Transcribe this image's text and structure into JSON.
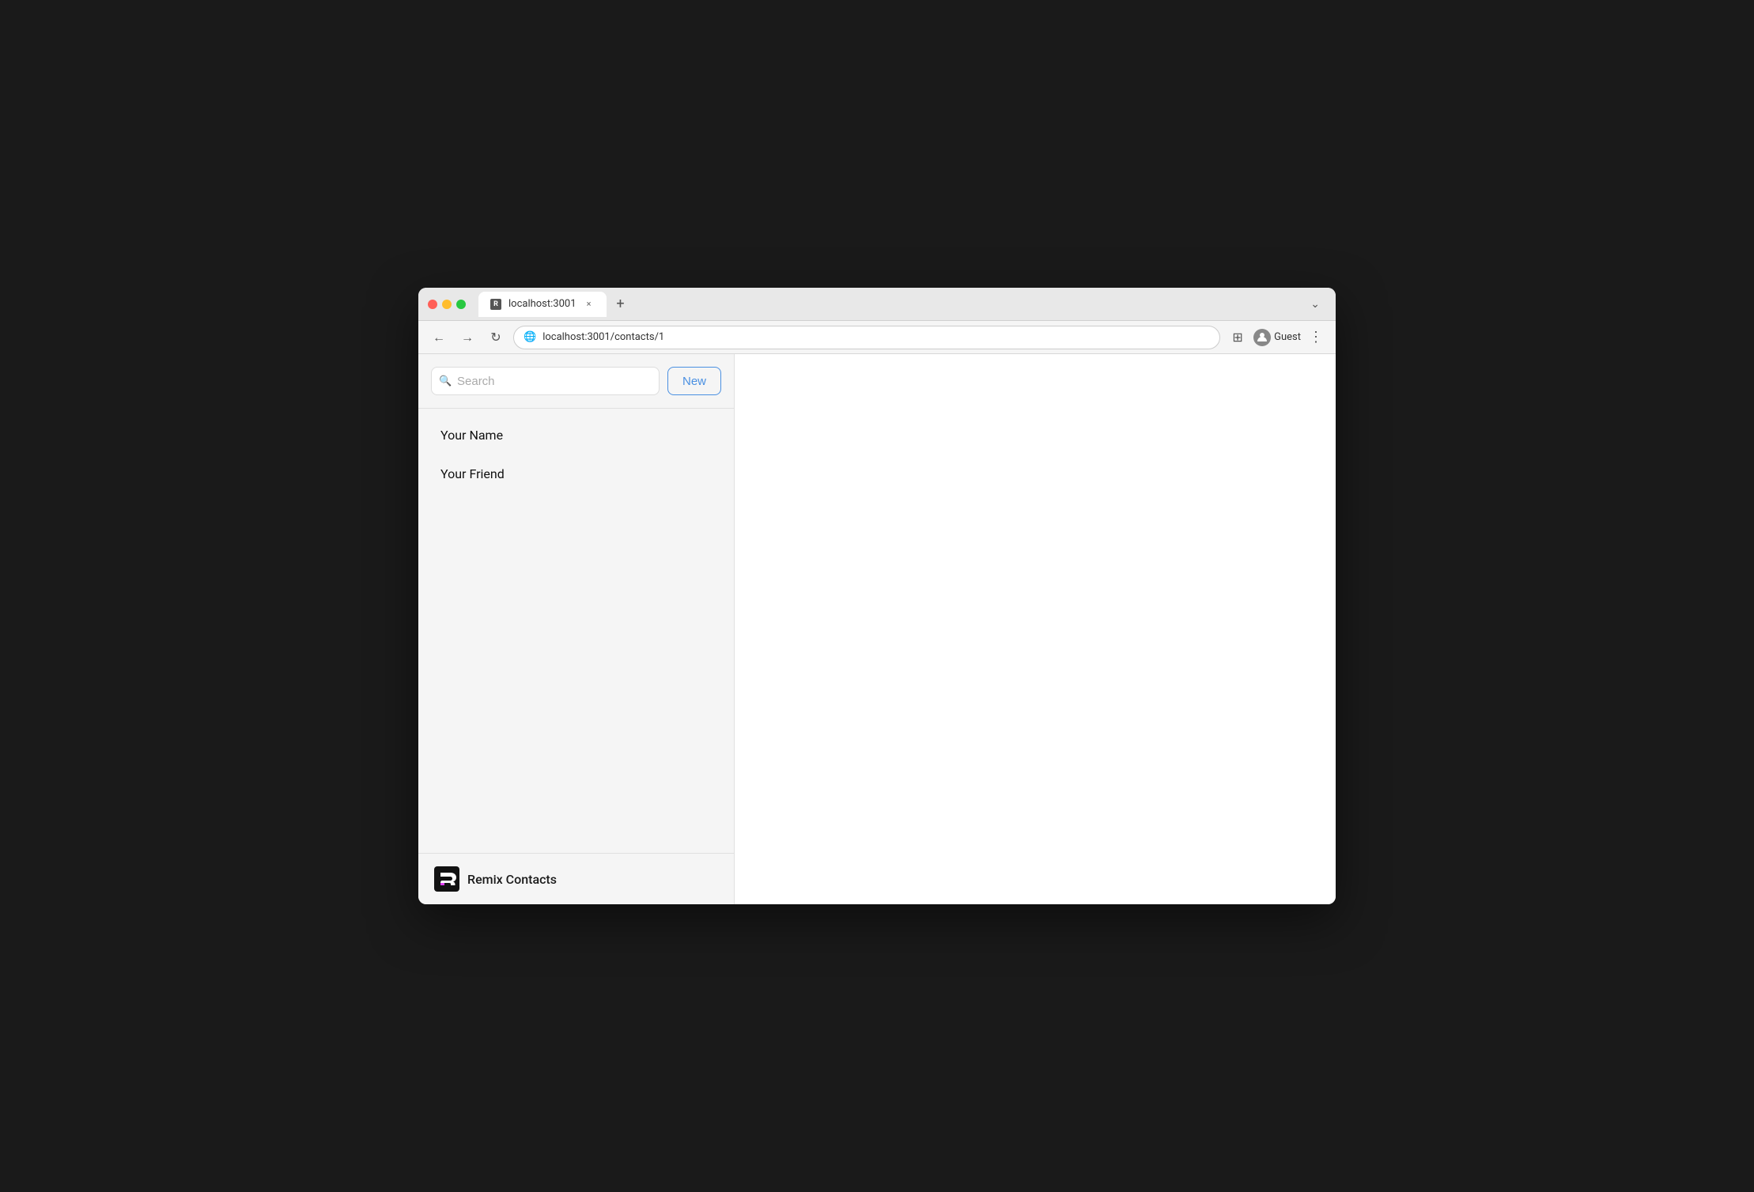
{
  "browser": {
    "tab_title": "localhost:3001",
    "tab_close": "×",
    "new_tab": "+",
    "chevron": "⌄",
    "nav": {
      "back": "←",
      "forward": "→",
      "refresh": "↻",
      "url": "localhost:3001/contacts/1",
      "extensions_icon": "🌐",
      "sidebar_icon": "⊞",
      "profile_label": "Guest",
      "menu": "⋮"
    }
  },
  "sidebar": {
    "search_placeholder": "Search",
    "new_button_label": "New",
    "contacts": [
      {
        "name": "Your Name"
      },
      {
        "name": "Your Friend"
      }
    ],
    "footer_text": "Remix Contacts"
  }
}
